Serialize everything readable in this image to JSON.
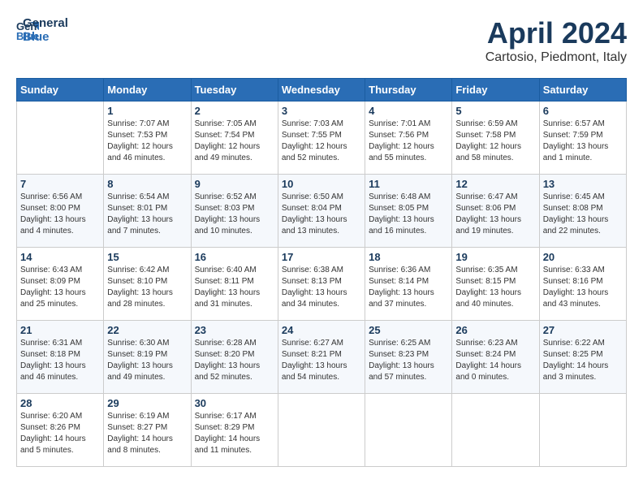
{
  "logo": {
    "line1": "General",
    "line2": "Blue"
  },
  "title": "April 2024",
  "subtitle": "Cartosio, Piedmont, Italy",
  "days_header": [
    "Sunday",
    "Monday",
    "Tuesday",
    "Wednesday",
    "Thursday",
    "Friday",
    "Saturday"
  ],
  "weeks": [
    [
      {
        "num": "",
        "detail": ""
      },
      {
        "num": "1",
        "detail": "Sunrise: 7:07 AM\nSunset: 7:53 PM\nDaylight: 12 hours\nand 46 minutes."
      },
      {
        "num": "2",
        "detail": "Sunrise: 7:05 AM\nSunset: 7:54 PM\nDaylight: 12 hours\nand 49 minutes."
      },
      {
        "num": "3",
        "detail": "Sunrise: 7:03 AM\nSunset: 7:55 PM\nDaylight: 12 hours\nand 52 minutes."
      },
      {
        "num": "4",
        "detail": "Sunrise: 7:01 AM\nSunset: 7:56 PM\nDaylight: 12 hours\nand 55 minutes."
      },
      {
        "num": "5",
        "detail": "Sunrise: 6:59 AM\nSunset: 7:58 PM\nDaylight: 12 hours\nand 58 minutes."
      },
      {
        "num": "6",
        "detail": "Sunrise: 6:57 AM\nSunset: 7:59 PM\nDaylight: 13 hours\nand 1 minute."
      }
    ],
    [
      {
        "num": "7",
        "detail": "Sunrise: 6:56 AM\nSunset: 8:00 PM\nDaylight: 13 hours\nand 4 minutes."
      },
      {
        "num": "8",
        "detail": "Sunrise: 6:54 AM\nSunset: 8:01 PM\nDaylight: 13 hours\nand 7 minutes."
      },
      {
        "num": "9",
        "detail": "Sunrise: 6:52 AM\nSunset: 8:03 PM\nDaylight: 13 hours\nand 10 minutes."
      },
      {
        "num": "10",
        "detail": "Sunrise: 6:50 AM\nSunset: 8:04 PM\nDaylight: 13 hours\nand 13 minutes."
      },
      {
        "num": "11",
        "detail": "Sunrise: 6:48 AM\nSunset: 8:05 PM\nDaylight: 13 hours\nand 16 minutes."
      },
      {
        "num": "12",
        "detail": "Sunrise: 6:47 AM\nSunset: 8:06 PM\nDaylight: 13 hours\nand 19 minutes."
      },
      {
        "num": "13",
        "detail": "Sunrise: 6:45 AM\nSunset: 8:08 PM\nDaylight: 13 hours\nand 22 minutes."
      }
    ],
    [
      {
        "num": "14",
        "detail": "Sunrise: 6:43 AM\nSunset: 8:09 PM\nDaylight: 13 hours\nand 25 minutes."
      },
      {
        "num": "15",
        "detail": "Sunrise: 6:42 AM\nSunset: 8:10 PM\nDaylight: 13 hours\nand 28 minutes."
      },
      {
        "num": "16",
        "detail": "Sunrise: 6:40 AM\nSunset: 8:11 PM\nDaylight: 13 hours\nand 31 minutes."
      },
      {
        "num": "17",
        "detail": "Sunrise: 6:38 AM\nSunset: 8:13 PM\nDaylight: 13 hours\nand 34 minutes."
      },
      {
        "num": "18",
        "detail": "Sunrise: 6:36 AM\nSunset: 8:14 PM\nDaylight: 13 hours\nand 37 minutes."
      },
      {
        "num": "19",
        "detail": "Sunrise: 6:35 AM\nSunset: 8:15 PM\nDaylight: 13 hours\nand 40 minutes."
      },
      {
        "num": "20",
        "detail": "Sunrise: 6:33 AM\nSunset: 8:16 PM\nDaylight: 13 hours\nand 43 minutes."
      }
    ],
    [
      {
        "num": "21",
        "detail": "Sunrise: 6:31 AM\nSunset: 8:18 PM\nDaylight: 13 hours\nand 46 minutes."
      },
      {
        "num": "22",
        "detail": "Sunrise: 6:30 AM\nSunset: 8:19 PM\nDaylight: 13 hours\nand 49 minutes."
      },
      {
        "num": "23",
        "detail": "Sunrise: 6:28 AM\nSunset: 8:20 PM\nDaylight: 13 hours\nand 52 minutes."
      },
      {
        "num": "24",
        "detail": "Sunrise: 6:27 AM\nSunset: 8:21 PM\nDaylight: 13 hours\nand 54 minutes."
      },
      {
        "num": "25",
        "detail": "Sunrise: 6:25 AM\nSunset: 8:23 PM\nDaylight: 13 hours\nand 57 minutes."
      },
      {
        "num": "26",
        "detail": "Sunrise: 6:23 AM\nSunset: 8:24 PM\nDaylight: 14 hours\nand 0 minutes."
      },
      {
        "num": "27",
        "detail": "Sunrise: 6:22 AM\nSunset: 8:25 PM\nDaylight: 14 hours\nand 3 minutes."
      }
    ],
    [
      {
        "num": "28",
        "detail": "Sunrise: 6:20 AM\nSunset: 8:26 PM\nDaylight: 14 hours\nand 5 minutes."
      },
      {
        "num": "29",
        "detail": "Sunrise: 6:19 AM\nSunset: 8:27 PM\nDaylight: 14 hours\nand 8 minutes."
      },
      {
        "num": "30",
        "detail": "Sunrise: 6:17 AM\nSunset: 8:29 PM\nDaylight: 14 hours\nand 11 minutes."
      },
      {
        "num": "",
        "detail": ""
      },
      {
        "num": "",
        "detail": ""
      },
      {
        "num": "",
        "detail": ""
      },
      {
        "num": "",
        "detail": ""
      }
    ]
  ]
}
